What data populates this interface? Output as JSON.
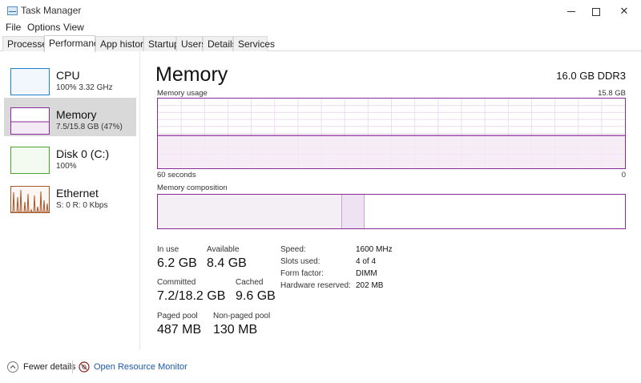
{
  "window": {
    "title": "Task Manager",
    "controls": {
      "minimize": "—",
      "close": "✕"
    }
  },
  "menu": [
    "File",
    "Options",
    "View"
  ],
  "tabs": [
    "Processes",
    "Performance",
    "App history",
    "Startup",
    "Users",
    "Details",
    "Services"
  ],
  "active_tab": "Performance",
  "sidebar": {
    "items": [
      {
        "name": "CPU",
        "detail": "100%  3.32 GHz",
        "color": "#1f7fd1"
      },
      {
        "name": "Memory",
        "detail": "7.5/15.8 GB (47%)",
        "color": "#8b2a9a"
      },
      {
        "name": "Disk 0 (C:)",
        "detail": "100%",
        "color": "#4da32d"
      },
      {
        "name": "Ethernet",
        "detail": "S: 0  R: 0 Kbps",
        "color": "#a5562a"
      }
    ],
    "selected": "Memory"
  },
  "main": {
    "title": "Memory",
    "spec": "16.0 GB DDR3",
    "usage_label": "Memory usage",
    "usage_max": "15.8 GB",
    "time_label": "60 seconds",
    "time_min": "0",
    "composition_label": "Memory composition",
    "usage_level": 0.47,
    "composition": {
      "in_use": 6.2,
      "modified": 0.8,
      "total": 15.8
    }
  },
  "stats": {
    "in_use": {
      "label": "In use",
      "value": "6.2 GB"
    },
    "available": {
      "label": "Available",
      "value": "8.4 GB"
    },
    "committed": {
      "label": "Committed",
      "value": "7.2/18.2 GB"
    },
    "cached": {
      "label": "Cached",
      "value": "9.6 GB"
    },
    "paged_pool": {
      "label": "Paged pool",
      "value": "487 MB"
    },
    "non_paged_pool": {
      "label": "Non-paged pool",
      "value": "130 MB"
    }
  },
  "specs": [
    {
      "key": "Speed:",
      "value": "1600 MHz"
    },
    {
      "key": "Slots used:",
      "value": "4 of 4"
    },
    {
      "key": "Form factor:",
      "value": "DIMM"
    },
    {
      "key": "Hardware reserved:",
      "value": "202 MB"
    }
  ],
  "footer": {
    "fewer_details": "Fewer details",
    "open_resource_monitor": "Open Resource Monitor"
  },
  "colors": {
    "memory_accent": "#8b2a9a",
    "memory_fill": "#f4eaf6",
    "link": "#1e5aa8"
  }
}
